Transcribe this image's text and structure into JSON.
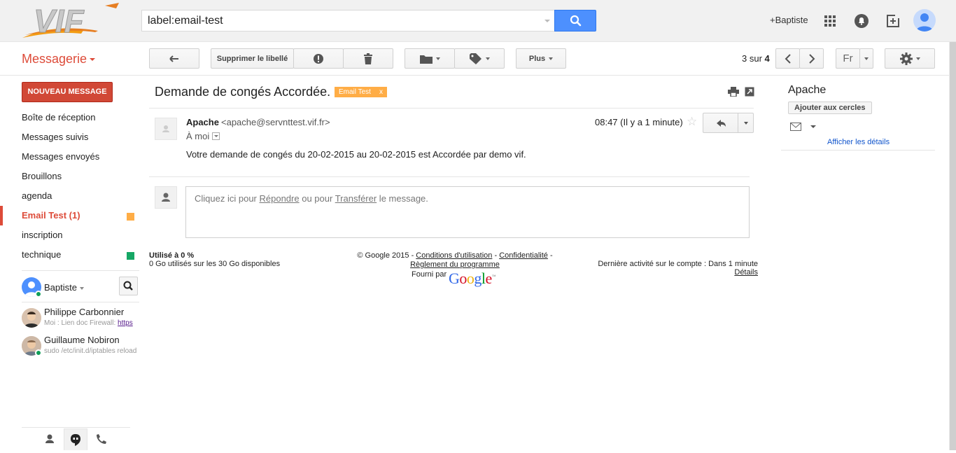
{
  "header": {
    "logo_text": "VIF",
    "search": {
      "value": "label:email-test"
    },
    "user_link": "+Baptiste",
    "icons": [
      "apps-grid-icon",
      "notifications-icon",
      "share-plus-icon",
      "account-avatar"
    ]
  },
  "toolbar": {
    "app_title": "Messagerie",
    "remove_label": "Supprimer le libellé",
    "more_label": "Plus",
    "pager": {
      "current": "3 sur ",
      "total": "4"
    },
    "language": "Fr"
  },
  "sidebar": {
    "compose_label": "NOUVEAU MESSAGE",
    "items": [
      {
        "label": "Boîte de réception"
      },
      {
        "label": "Messages suivis"
      },
      {
        "label": "Messages envoyés"
      },
      {
        "label": "Brouillons"
      },
      {
        "label": "agenda"
      },
      {
        "label": "Email Test (1)",
        "active": true,
        "color": "#ffad46"
      },
      {
        "label": "inscription"
      },
      {
        "label": "technique",
        "color": "#16a765"
      }
    ],
    "chat": {
      "me": "Baptiste",
      "contacts": [
        {
          "name": "Philippe Carbonnier",
          "snippet_prefix": "Moi : Lien doc Firewall: ",
          "snippet_link": "https"
        },
        {
          "name": "Guillaume Nobiron",
          "snippet_prefix": "sudo /etc/init.d/iptables reload",
          "snippet_link": ""
        }
      ]
    }
  },
  "thread": {
    "subject": "Demande de congés Accordée.",
    "label_chip": "Email Test",
    "label_chip_close": "x",
    "sender_name": "Apache",
    "sender_email": "<apache@servnttest.vif.fr>",
    "to": "À moi",
    "time": "08:47 (Il y a 1 minute)",
    "body": "Votre demande de congés du 20-02-2015 au 20-02-2015 est Accordée par demo vif.",
    "reply_prompt": {
      "a": "Cliquez ici pour ",
      "reply": "Répondre",
      "b": " ou pour ",
      "forward": "Transférer",
      "c": " le message."
    }
  },
  "footer": {
    "storage_title": "Utilisé à 0 %",
    "storage_detail": "0 Go utilisés sur les 30 Go disponibles",
    "copyright": "© Google 2015 - ",
    "terms": "Conditions d'utilisation",
    "sep1": " - ",
    "privacy": "Confidentialité",
    "sep2": " -",
    "program": "Règlement du programme",
    "powered_by": "Fourni par",
    "google": "Google",
    "last_activity": "Dernière activité sur le compte : Dans 1 minute",
    "details": "Détails"
  },
  "contact_card": {
    "name": "Apache",
    "add_button": "Ajouter aux cercles",
    "show_details": "Afficher les détails"
  },
  "colors": {
    "accent_red": "#dd4b39",
    "compose_red": "#d14836",
    "search_blue": "#4d90fe",
    "label_orange": "#ffad46",
    "label_green": "#16a765"
  }
}
